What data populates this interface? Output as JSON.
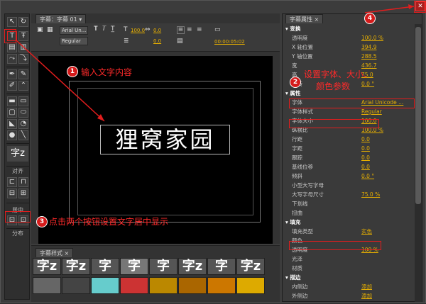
{
  "main": {
    "tab_label": "字幕：字幕 01",
    "font_select": "Arial Un...",
    "style_select": "Regular",
    "size_value": "100.0",
    "kerning_value": "0.0",
    "leading_value": "0.0",
    "timecode": "00:00:05:02",
    "canvas_text": "狸窝家园"
  },
  "tools": {
    "align_label": "对齐",
    "center_label": "居中",
    "distribute_label": "分布",
    "swatch_label": "字z"
  },
  "styles_panel": {
    "tab_label": "字幕样式",
    "swatches": [
      "字z",
      "字z",
      "字",
      "字",
      "字",
      "字z",
      "字",
      "字z"
    ]
  },
  "props": {
    "tab_label": "字幕属性",
    "sections": {
      "transform": "变换",
      "properties": "属性",
      "fill": "填充",
      "stroke": "描边"
    },
    "rows": [
      {
        "label": "透明度",
        "value": "100.0 %"
      },
      {
        "label": "X 轴位置",
        "value": "394.9"
      },
      {
        "label": "Y 轴位置",
        "value": "288.5"
      },
      {
        "label": "宽",
        "value": "436.7"
      },
      {
        "label": "高",
        "value": "75.0"
      },
      {
        "label": "旋转",
        "value": "0.0 °"
      }
    ],
    "props_rows": [
      {
        "label": "字体",
        "value": "Arial Unicode ..."
      },
      {
        "label": "字体样式",
        "value": "Regular"
      },
      {
        "label": "字体大小",
        "value": "100.0"
      },
      {
        "label": "纵横比",
        "value": "100.0 %"
      },
      {
        "label": "行距",
        "value": "0.0"
      },
      {
        "label": "字距",
        "value": "0.0"
      },
      {
        "label": "跟踪",
        "value": "0.0"
      },
      {
        "label": "基线位移",
        "value": "0.0"
      },
      {
        "label": "倾斜",
        "value": "0.0 °"
      },
      {
        "label": "小型大写字母",
        "value": ""
      },
      {
        "label": "大写字母尺寸",
        "value": "75.0 %"
      },
      {
        "label": "下划线",
        "value": ""
      },
      {
        "label": "扭曲",
        "value": ""
      }
    ],
    "fill_rows": [
      {
        "label": "填充类型",
        "value": "实色"
      },
      {
        "label": "颜色",
        "value": ""
      },
      {
        "label": "透明度",
        "value": "100 %"
      },
      {
        "label": "光泽",
        "value": ""
      },
      {
        "label": "材质",
        "value": ""
      }
    ],
    "stroke_rows": [
      {
        "label": "内侧边",
        "value": "添加"
      },
      {
        "label": "外侧边",
        "value": "添加"
      }
    ]
  },
  "annotations": {
    "note1": "输入文字内容",
    "note2_line1": "设置字体、大小、",
    "note2_line2": "颜色参数",
    "note3": "点击两个按钮设置文字居中显示",
    "n1": "1",
    "n2": "2",
    "n3": "3",
    "n4": "4"
  },
  "colors": {
    "accent": "#e8b000",
    "annotation": "#e21d1d"
  }
}
